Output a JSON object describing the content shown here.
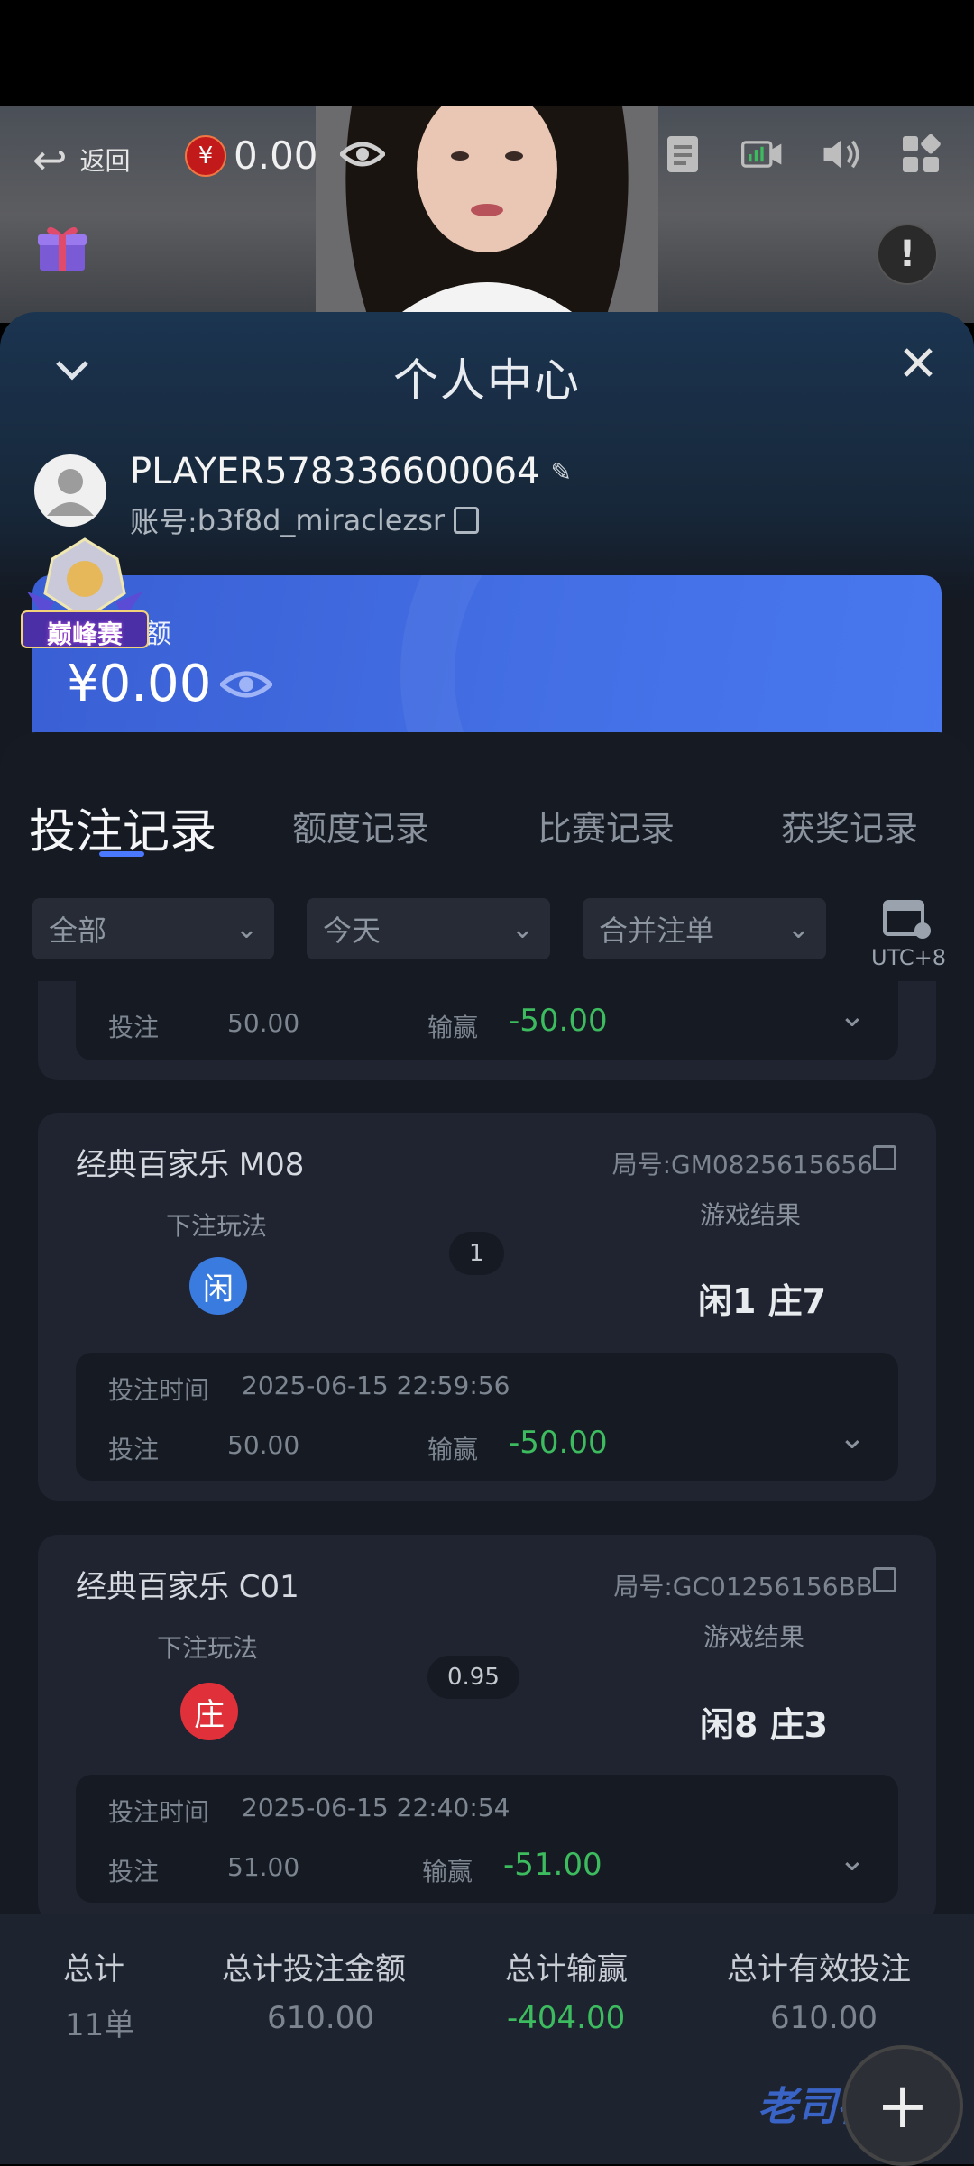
{
  "topbar": {
    "back_label": "返回",
    "balance": "0.00",
    "currency_symbol": "¥"
  },
  "panel": {
    "title": "个人中心",
    "player_name": "PLAYER578336600064",
    "account_label": "账号:",
    "account_value": "b3f8d_miraclezsr",
    "balance_label": "余额",
    "balance_amount": "¥0.00",
    "badge_text": "巅峰赛"
  },
  "tabs": [
    {
      "label": "投注记录",
      "active": true
    },
    {
      "label": "额度记录",
      "active": false
    },
    {
      "label": "比赛记录",
      "active": false
    },
    {
      "label": "获奖记录",
      "active": false
    }
  ],
  "filters": {
    "type": "全部",
    "date": "今天",
    "merge": "合并注单",
    "timezone": "UTC+8"
  },
  "records": [
    {
      "partial": true,
      "bet_label": "投注",
      "bet": "50.00",
      "win_label": "输赢",
      "win": "-50.00"
    },
    {
      "game": "经典百家乐 M08",
      "round_id": "局号:GM0825615656",
      "play_label": "下注玩法",
      "bet_type": "闲",
      "bet_color": "#3a7be0",
      "odds": "1",
      "result_label": "游戏结果",
      "result": "闲1 庄7",
      "time_label": "投注时间",
      "time": "2025-06-15 22:59:56",
      "bet_label": "投注",
      "bet": "50.00",
      "win_label": "输赢",
      "win": "-50.00"
    },
    {
      "game": "经典百家乐 C01",
      "round_id": "局号:GC01256156BB",
      "play_label": "下注玩法",
      "bet_type": "庄",
      "bet_color": "#e0303a",
      "odds": "0.95",
      "result_label": "游戏结果",
      "result": "闲8 庄3",
      "time_label": "投注时间",
      "time": "2025-06-15 22:40:54",
      "bet_label": "投注",
      "bet": "51.00",
      "win_label": "输赢",
      "win": "-51.00"
    }
  ],
  "summary": {
    "total_label": "总计",
    "total_value": "11单",
    "bet_label": "总计投注金额",
    "bet_value": "610.00",
    "win_label": "总计输赢",
    "win_value": "-404.00",
    "valid_label": "总计有效投注",
    "valid_value": "610.00"
  },
  "watermark": "老司社区"
}
